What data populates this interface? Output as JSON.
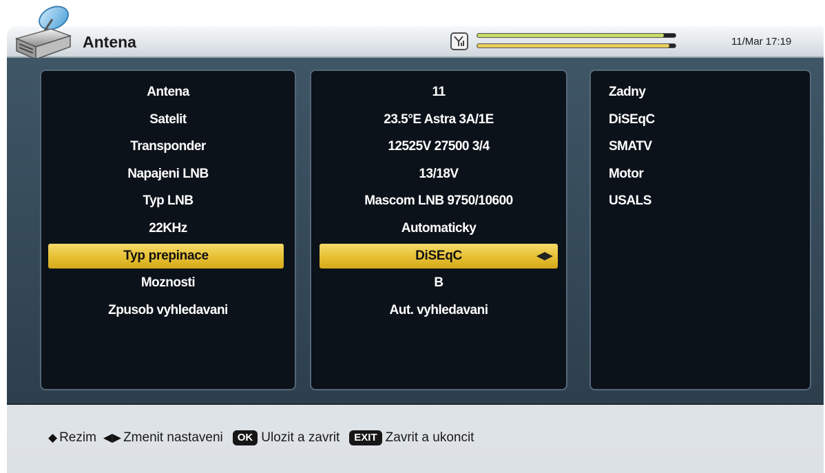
{
  "header": {
    "title": "Antena",
    "datetime": "11/Mar 17:19",
    "signal_strength": 0.94,
    "signal_quality": 0.97,
    "signal_icon": "signal-antenna-icon",
    "logo_icon": "satellite-receiver-icon"
  },
  "settings": {
    "labels": [
      "Antena",
      "Satelit",
      "Transponder",
      "Napajeni LNB",
      "Typ LNB",
      "22KHz",
      "Typ prepinace",
      "Moznosti",
      "Zpusob vyhledavani"
    ],
    "values": [
      "11",
      "23.5°E Astra 3A/1E",
      "12525V 27500 3/4",
      "13/18V",
      "Mascom LNB 9750/10600",
      "Automaticky",
      "DiSEqC",
      "B",
      "Aut. vyhledavani"
    ],
    "selected_index": 6
  },
  "switch_options": [
    "Zadny",
    "DiSEqC",
    "SMATV",
    "Motor",
    "USALS"
  ],
  "help": {
    "rezim": "Rezim",
    "zmenit": "Zmenit nastaveni",
    "ok_key": "OK",
    "ok_text": "Ulozit a zavrit",
    "exit_key": "EXIT",
    "exit_text": "Zavrit a ukoncit"
  },
  "colors": {
    "highlight": "#e6bf32",
    "strength_bar": "#c7db6a",
    "quality_bar": "#ead05c",
    "panel_bg": "#0c121a",
    "content_bg": "#3f5666"
  }
}
